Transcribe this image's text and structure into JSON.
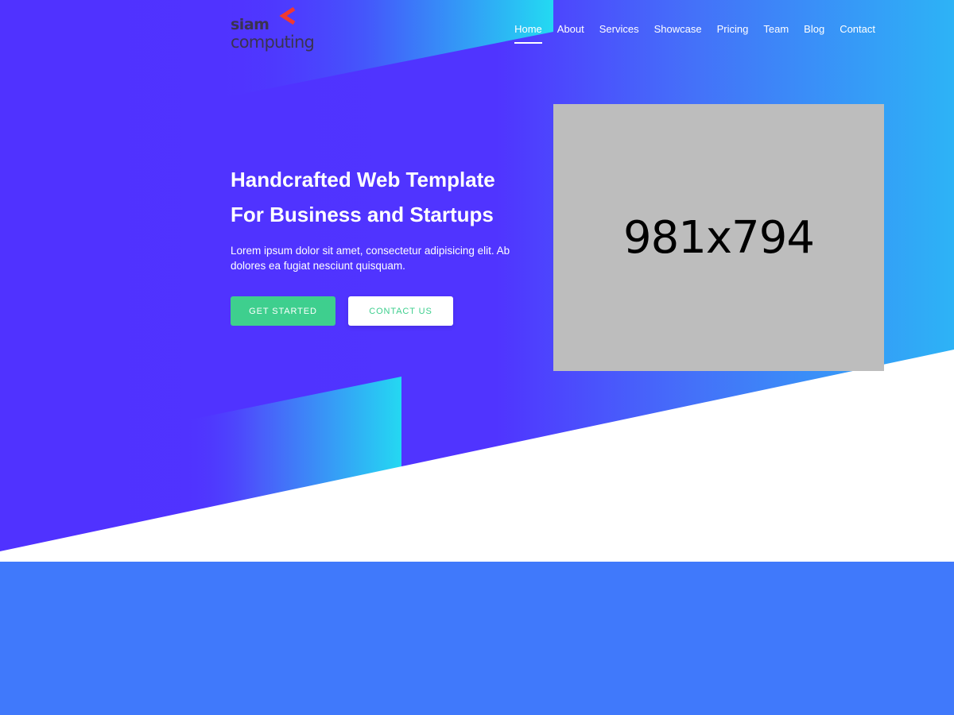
{
  "colors": {
    "hero_base": "#5034ff",
    "hero_cyan": "#24d6f2",
    "hero_mid": "#3f8cf7",
    "accent_green": "#3ecf8e",
    "logo_red": "#f1392f",
    "logo_text": "#3a3350",
    "placeholder_bg": "#bdbdbd",
    "next_section": "#4079fb"
  },
  "header": {
    "logo": {
      "line1": "siam",
      "line2": "computing",
      "mark_icon": "chevron-left-icon"
    },
    "nav": [
      {
        "label": "Home",
        "active": true
      },
      {
        "label": "About",
        "active": false
      },
      {
        "label": "Services",
        "active": false
      },
      {
        "label": "Showcase",
        "active": false
      },
      {
        "label": "Pricing",
        "active": false
      },
      {
        "label": "Team",
        "active": false
      },
      {
        "label": "Blog",
        "active": false
      },
      {
        "label": "Contact",
        "active": false
      }
    ]
  },
  "hero": {
    "title_line1": "Handcrafted Web Template",
    "title_line2": "For Business and Startups",
    "text": "Lorem ipsum dolor sit amet, consectetur adipisicing elit. Ab dolores ea fugiat nesciunt quisquam.",
    "primary_button": "GET STARTED",
    "secondary_button": "CONTACT US",
    "image_placeholder": "981x794"
  }
}
